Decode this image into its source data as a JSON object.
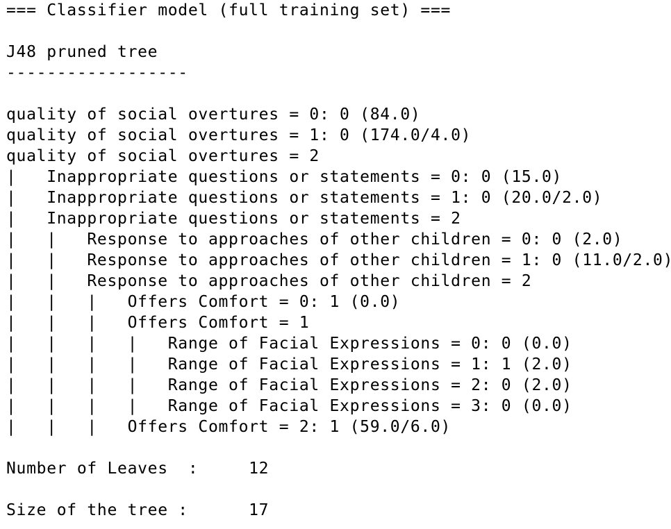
{
  "output": {
    "header": "=== Classifier model (full training set) ===",
    "tree_title": "J48 pruned tree",
    "underline": "------------------",
    "tree_lines": [
      "quality of social overtures = 0: 0 (84.0)",
      "quality of social overtures = 1: 0 (174.0/4.0)",
      "quality of social overtures = 2",
      "|   Inappropriate questions or statements = 0: 0 (15.0)",
      "|   Inappropriate questions or statements = 1: 0 (20.0/2.0)",
      "|   Inappropriate questions or statements = 2",
      "|   |   Response to approaches of other children = 0: 0 (2.0)",
      "|   |   Response to approaches of other children = 1: 0 (11.0/2.0)",
      "|   |   Response to approaches of other children = 2",
      "|   |   |   Offers Comfort = 0: 1 (0.0)",
      "|   |   |   Offers Comfort = 1",
      "|   |   |   |   Range of Facial Expressions = 0: 0 (0.0)",
      "|   |   |   |   Range of Facial Expressions = 1: 1 (2.0)",
      "|   |   |   |   Range of Facial Expressions = 2: 0 (2.0)",
      "|   |   |   |   Range of Facial Expressions = 3: 0 (0.0)",
      "|   |   |   Offers Comfort = 2: 1 (59.0/6.0)"
    ],
    "leaves_line": "Number of Leaves  :     12",
    "size_line": "Size of the tree :      17"
  }
}
